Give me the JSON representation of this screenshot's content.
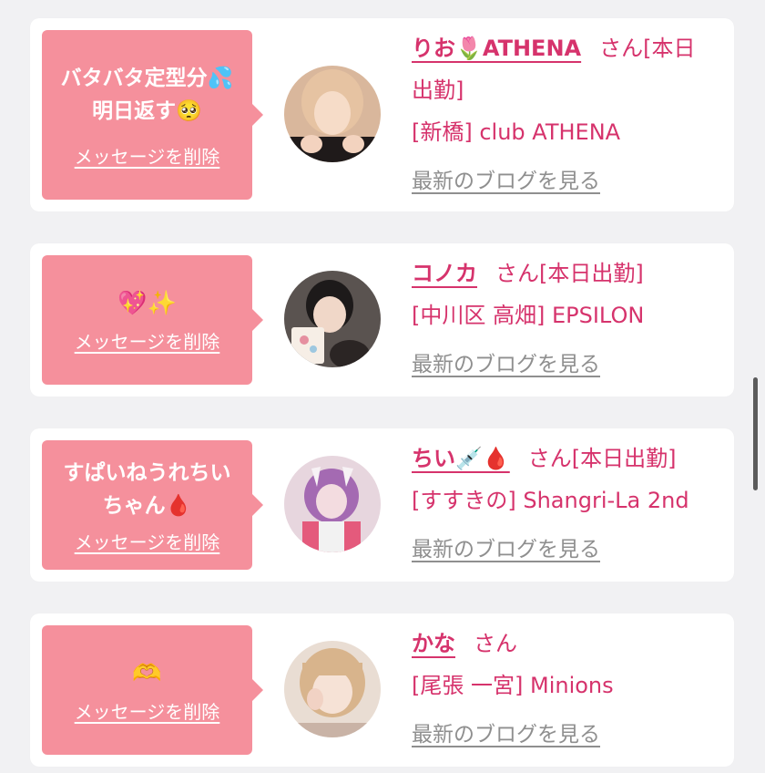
{
  "cards": [
    {
      "message": "バタバタ定型分💦\n明日返す🥺",
      "delete_label": "メッセージを削除",
      "name": "りお🌷ATHENA",
      "san": "さん",
      "status": "[本日出勤]",
      "shop": "[新橋] club ATHENA",
      "blog": "最新のブログを見る"
    },
    {
      "message": "💖✨",
      "delete_label": "メッセージを削除",
      "name": "コノカ",
      "san": "さん",
      "status": "[本日出勤]",
      "shop": "[中川区 高畑] EPSILON",
      "blog": "最新のブログを見る"
    },
    {
      "message": "すぱいねうれちい\nちゃん🩸",
      "delete_label": "メッセージを削除",
      "name": "ちい💉🩸",
      "san": "さん",
      "status": "[本日出勤]",
      "shop": "[すすきの] Shangri-La 2nd",
      "blog": "最新のブログを見る"
    },
    {
      "message": "🫶",
      "delete_label": "メッセージを削除",
      "name": "かな",
      "san": "さん",
      "status": "",
      "shop": "[尾張 一宮] Minions",
      "blog": "最新のブログを見る"
    }
  ],
  "colors": {
    "bubble": "#f5909c",
    "accent": "#d6336c",
    "link_gray": "#8f8f8f"
  }
}
